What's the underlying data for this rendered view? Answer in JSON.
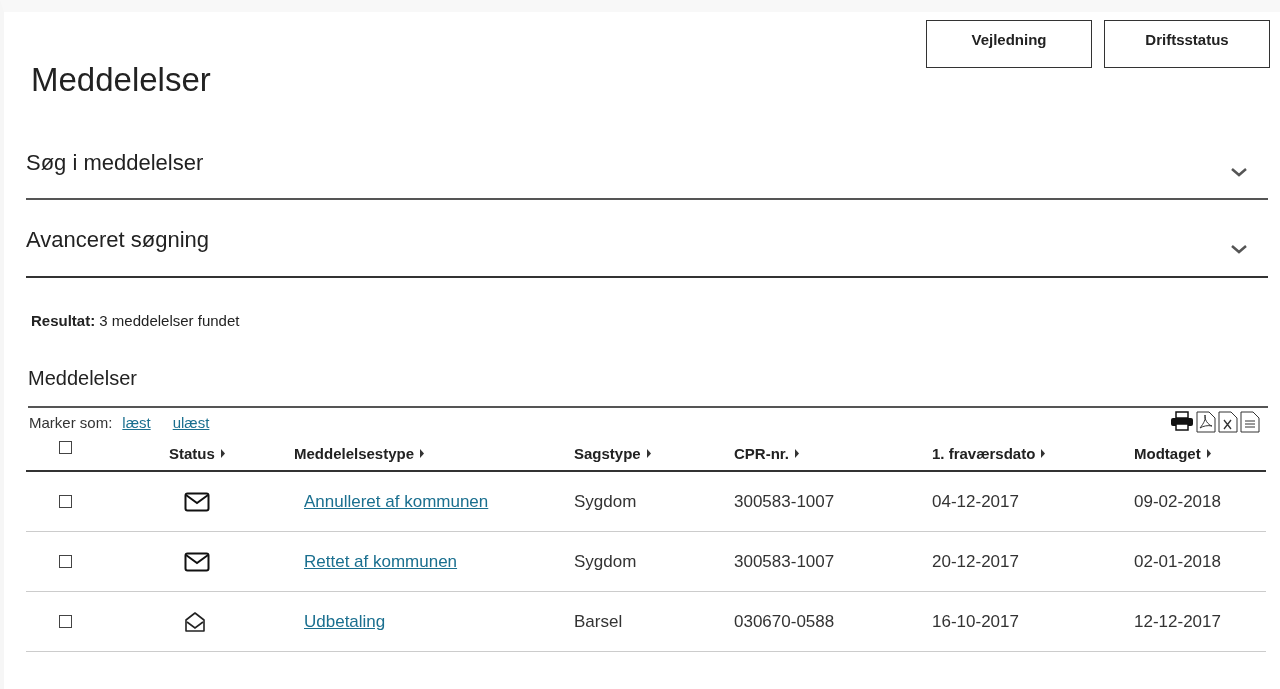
{
  "header_buttons": [
    "Vejledning",
    "Driftsstatus"
  ],
  "title": "Meddelelser",
  "sections": [
    {
      "label": "Søg i meddelelser",
      "expanded": false
    },
    {
      "label": "Avanceret søgning",
      "expanded": false
    }
  ],
  "result": {
    "label": "Resultat:",
    "text": "3 meddelelser fundet"
  },
  "list_title": "Meddelelser",
  "mark_as": {
    "label": "Marker som:",
    "links": [
      "læst",
      "ulæst"
    ]
  },
  "table": {
    "select_all": {
      "checked": false
    },
    "columns": [
      "Status",
      "Meddelelsestype",
      "Sagstype",
      "CPR-nr.",
      "1. fraværsdato",
      "Modtaget"
    ],
    "rows": [
      {
        "checked": false,
        "read": false,
        "type": "Annulleret af kommunen",
        "case": "Sygdom",
        "cpr": "300583-1007",
        "absence_date": "04-12-2017",
        "received": "09-02-2018"
      },
      {
        "checked": false,
        "read": false,
        "type": "Rettet af kommunen",
        "case": "Sygdom",
        "cpr": "300583-1007",
        "absence_date": "20-12-2017",
        "received": "02-01-2018"
      },
      {
        "checked": false,
        "read": true,
        "type": "Udbetaling",
        "case": "Barsel",
        "cpr": "030670-0588",
        "absence_date": "16-10-2017",
        "received": "12-12-2017"
      }
    ]
  }
}
